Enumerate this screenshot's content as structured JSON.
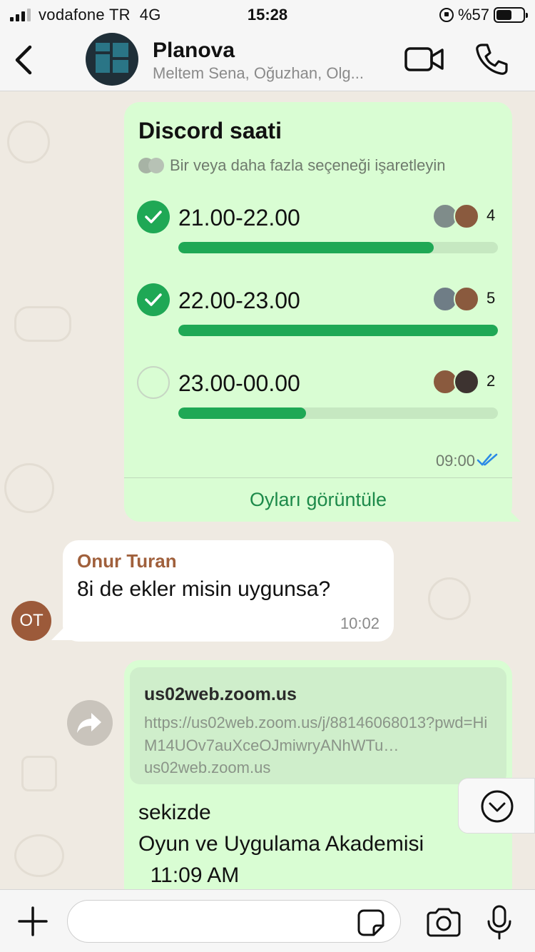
{
  "status_bar": {
    "carrier": "vodafone TR",
    "network": "4G",
    "time": "15:28",
    "battery": "%57",
    "battery_level": 0.57
  },
  "header": {
    "title": "Planova",
    "subtitle": "Meltem Sena, Oğuzhan, Olg..."
  },
  "poll": {
    "question": "Discord saati",
    "hint": "Bir veya daha fazla seçeneği işaretleyin",
    "options": [
      {
        "label": "21.00-22.00",
        "count": "4",
        "checked": true,
        "fill": 0.8
      },
      {
        "label": "22.00-23.00",
        "count": "5",
        "checked": true,
        "fill": 1.0
      },
      {
        "label": "23.00-00.00",
        "count": "2",
        "checked": false,
        "fill": 0.4
      }
    ],
    "time": "09:00",
    "view_votes": "Oyları görüntüle"
  },
  "incoming": {
    "sender": "Onur Turan",
    "sender_initials": "OT",
    "text": "8i de ekler misin uygunsa?",
    "time": "10:02"
  },
  "link_message": {
    "preview_title": "us02web.zoom.us",
    "preview_url": "https://us02web.zoom.us/j/88146068013?pwd=HiM14UOv7auXceOJmiwryANhWTu…",
    "preview_domain": "us02web.zoom.us",
    "lines": [
      "sekizde",
      "Oyun ve Uygulama Akademisi",
      "  11:09 AM"
    ]
  },
  "composer": {
    "placeholder": ""
  },
  "colors": {
    "outgoing_bubble": "#d9fdd3",
    "accent_green": "#1fa855",
    "read_ticks": "#2b8ae6",
    "sender_name": "#a0603c"
  }
}
